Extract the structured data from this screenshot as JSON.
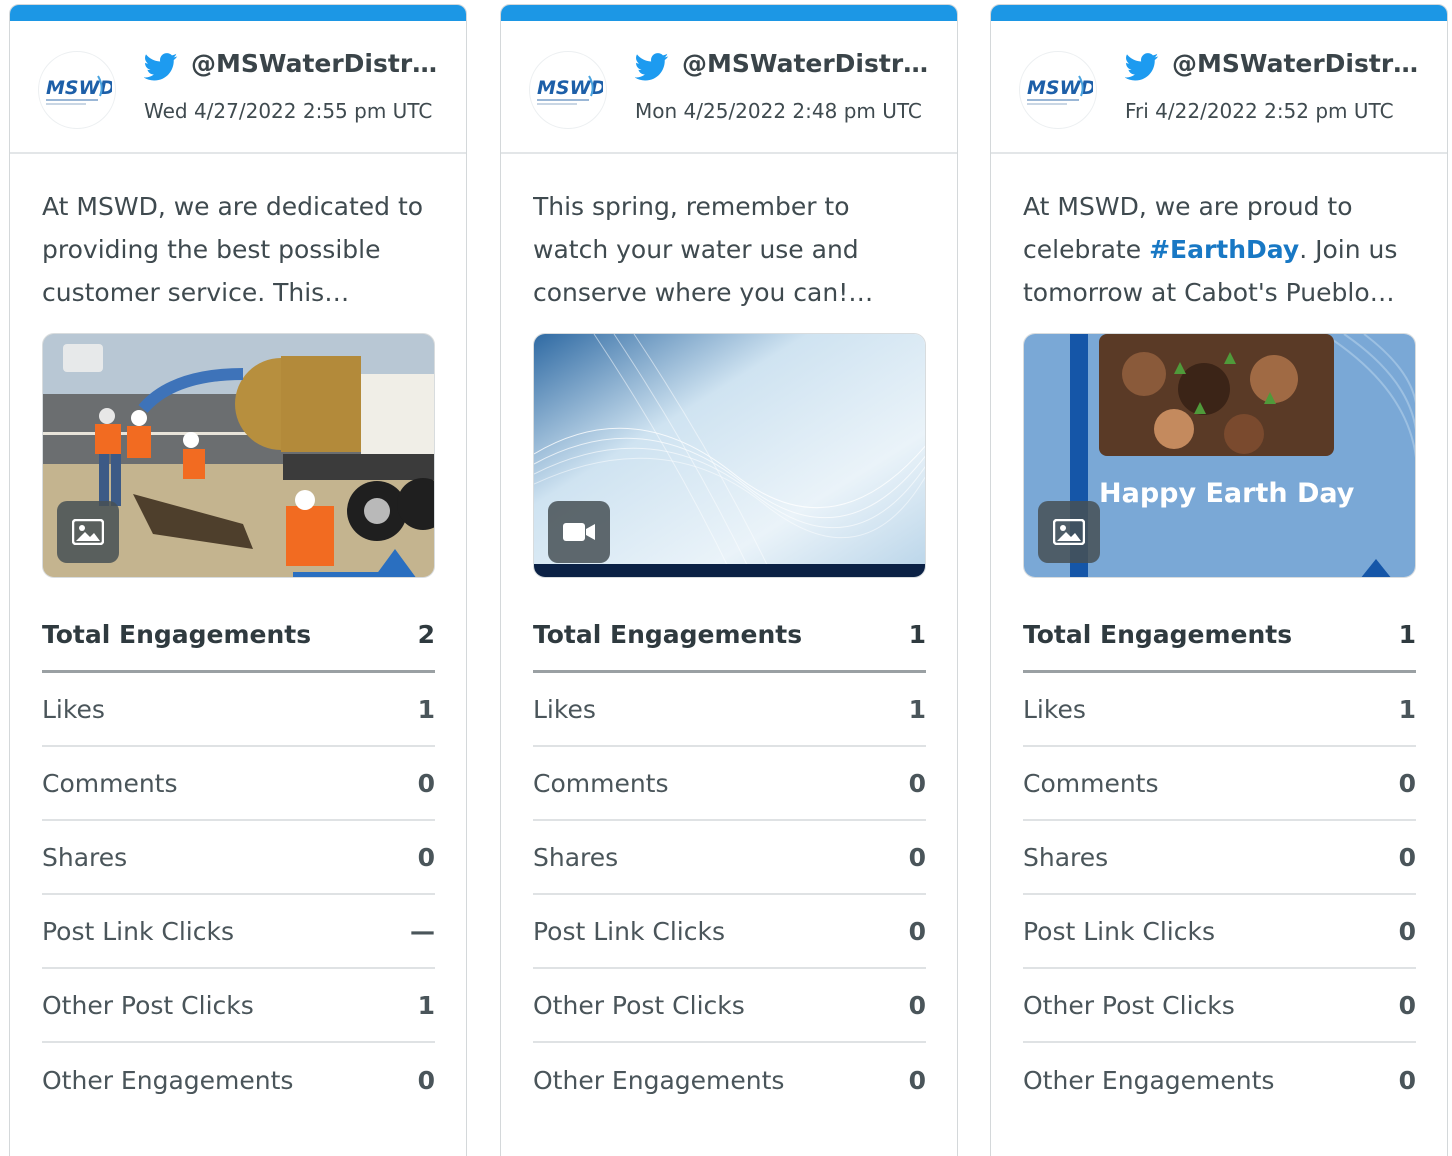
{
  "accent_color": "#1c97e5",
  "posts": [
    {
      "logo_text": "MSWD",
      "handle": "@MSWaterDistrict",
      "timestamp": "Wed 4/27/2022 2:55 pm UTC",
      "text_lines": [
        "At MSWD, we are dedicated to",
        "providing the best possible",
        "customer service. This…"
      ],
      "media_type_icon": "image-icon",
      "metrics": {
        "total_label": "Total Engagements",
        "total_value": "2",
        "rows": [
          {
            "label": "Likes",
            "value": "1"
          },
          {
            "label": "Comments",
            "value": "0"
          },
          {
            "label": "Shares",
            "value": "0"
          },
          {
            "label": "Post Link Clicks",
            "value": "—"
          },
          {
            "label": "Other Post Clicks",
            "value": "1"
          },
          {
            "label": "Other Engagements",
            "value": "0"
          }
        ]
      }
    },
    {
      "logo_text": "MSWD",
      "handle": "@MSWaterDistrict",
      "timestamp": "Mon 4/25/2022 2:48 pm UTC",
      "text_lines": [
        "This spring, remember to",
        "watch your water use and",
        "conserve where you can!…"
      ],
      "media_type_icon": "video-icon",
      "metrics": {
        "total_label": "Total Engagements",
        "total_value": "1",
        "rows": [
          {
            "label": "Likes",
            "value": "1"
          },
          {
            "label": "Comments",
            "value": "0"
          },
          {
            "label": "Shares",
            "value": "0"
          },
          {
            "label": "Post Link Clicks",
            "value": "0"
          },
          {
            "label": "Other Post Clicks",
            "value": "0"
          },
          {
            "label": "Other Engagements",
            "value": "0"
          }
        ]
      }
    },
    {
      "logo_text": "MSWD",
      "handle": "@MSWaterDistrict",
      "timestamp": "Fri 4/22/2022 2:52 pm UTC",
      "text_line1": "At MSWD, we are proud to",
      "text_line2_pre": "celebrate ",
      "text_line2_hashtag": "#EarthDay",
      "text_line2_post": ". Join us",
      "text_line3": "tomorrow at Cabot's Pueblo…",
      "media_caption": "Happy Earth Day",
      "media_type_icon": "image-icon",
      "metrics": {
        "total_label": "Total Engagements",
        "total_value": "1",
        "rows": [
          {
            "label": "Likes",
            "value": "1"
          },
          {
            "label": "Comments",
            "value": "0"
          },
          {
            "label": "Shares",
            "value": "0"
          },
          {
            "label": "Post Link Clicks",
            "value": "0"
          },
          {
            "label": "Other Post Clicks",
            "value": "0"
          },
          {
            "label": "Other Engagements",
            "value": "0"
          }
        ]
      }
    }
  ]
}
